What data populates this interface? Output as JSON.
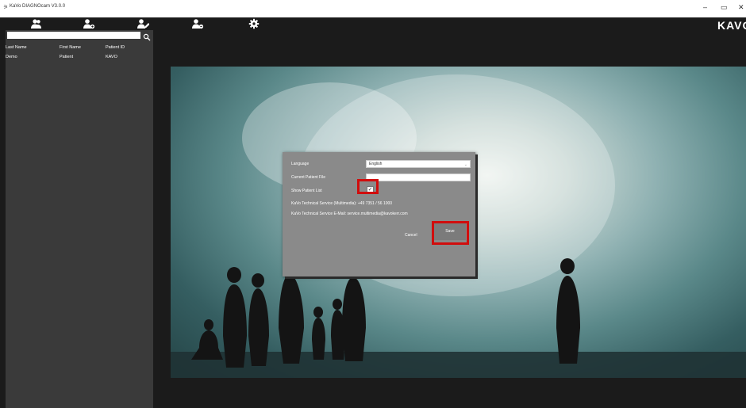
{
  "window": {
    "title": "KaVo DIAGNOcam V3.0.0",
    "minimize": "–",
    "maximize": "▭",
    "close": "✕"
  },
  "brand": {
    "logo": "KAVO"
  },
  "toolbar": {
    "icons": [
      "patients-icon",
      "add-patient-icon",
      "edit-patient-icon",
      "delete-patient-icon",
      "settings-icon"
    ]
  },
  "sidebar": {
    "search": {
      "value": "",
      "placeholder": ""
    },
    "columns": [
      "Last Name",
      "First Name",
      "Patient ID"
    ],
    "rows": [
      {
        "last_name": "Demo",
        "first_name": "Patient",
        "patient_id": "KAVO"
      }
    ]
  },
  "dialog": {
    "language_label": "Language",
    "language_value": "English",
    "current_file_label": "Current Patient File",
    "current_file_value": "",
    "show_list_label": "Show Patient List",
    "show_list_checked": true,
    "service_phone": "KaVo Technical Service (Multimedia): +49 7351 / 56 1000",
    "service_email": "KaVo Technical Service E-Mail: service.multimedia@kavokerr.com",
    "cancel_label": "Cancel",
    "save_label": "Save"
  },
  "colors": {
    "highlight": "#d10d0d",
    "background": "#1b1b1b",
    "sidebar": "#3a3a3a",
    "dialog": "#8a8a8a"
  }
}
